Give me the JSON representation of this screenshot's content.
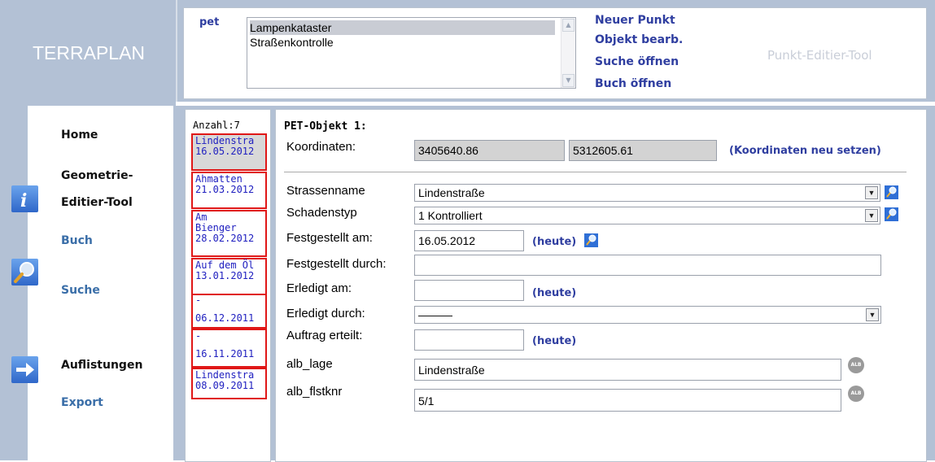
{
  "logo": {
    "text": "TERRAPLAN"
  },
  "top": {
    "pet_label": "pet",
    "list_items": [
      "Lampenkataster",
      "Straßenkontrolle"
    ],
    "selected_index": 0,
    "actions": [
      "Neuer Punkt",
      "Objekt bearb.",
      "Suche öffnen",
      "Buch öffnen"
    ],
    "tool_title": "Punkt-Editier-Tool"
  },
  "nav": {
    "home": "Home",
    "geometrie1": "Geometrie-",
    "geometrie2": "Editier-Tool",
    "buch": "Buch",
    "suche": "Suche",
    "auflistungen": "Auflistungen",
    "export": "Export"
  },
  "list": {
    "count_label": "Anzahl:7",
    "items": [
      {
        "l1": "Lindenstra",
        "l2": "16.05.2012"
      },
      {
        "l1": "Ahmatten",
        "l2": "21.03.2012"
      },
      {
        "l1": "Am",
        "l2": "Bienger",
        "l3": "28.02.2012"
      },
      {
        "l1": "Auf dem Öl",
        "l2": "13.01.2012"
      },
      {
        "l1": "-",
        "l2": "06.12.2011"
      },
      {
        "l1": "-",
        "l2": "16.11.2011"
      },
      {
        "l1": "Lindenstra",
        "l2": "08.09.2011"
      }
    ]
  },
  "form": {
    "object_title": "PET-Objekt 1:",
    "koord_label": "Koordinaten:",
    "koord_x": "3405640.86",
    "koord_y": "5312605.61",
    "koord_reset": "(Koordinaten neu setzen)",
    "strassenname_label": "Strassenname",
    "strassenname_value": "Lindenstraße",
    "schadenstyp_label": "Schadenstyp",
    "schadenstyp_value": "1 Kontrolliert",
    "festgestellt_am_label": "Festgestellt am:",
    "festgestellt_am_value": "16.05.2012",
    "festgestellt_durch_label": "Festgestellt durch:",
    "festgestellt_durch_value": "",
    "erledigt_am_label": "Erledigt am:",
    "erledigt_am_value": "",
    "erledigt_durch_label": "Erledigt durch:",
    "erledigt_durch_value": "———",
    "auftrag_label": "Auftrag erteilt:",
    "auftrag_value": "",
    "heute": "(heute)",
    "alb_lage_label": "alb_lage",
    "alb_lage_value": "Lindenstraße",
    "alb_flstknr_label": "alb_flstknr",
    "alb_flstknr_value": "5/1",
    "alb_icon_text": "ALB"
  }
}
